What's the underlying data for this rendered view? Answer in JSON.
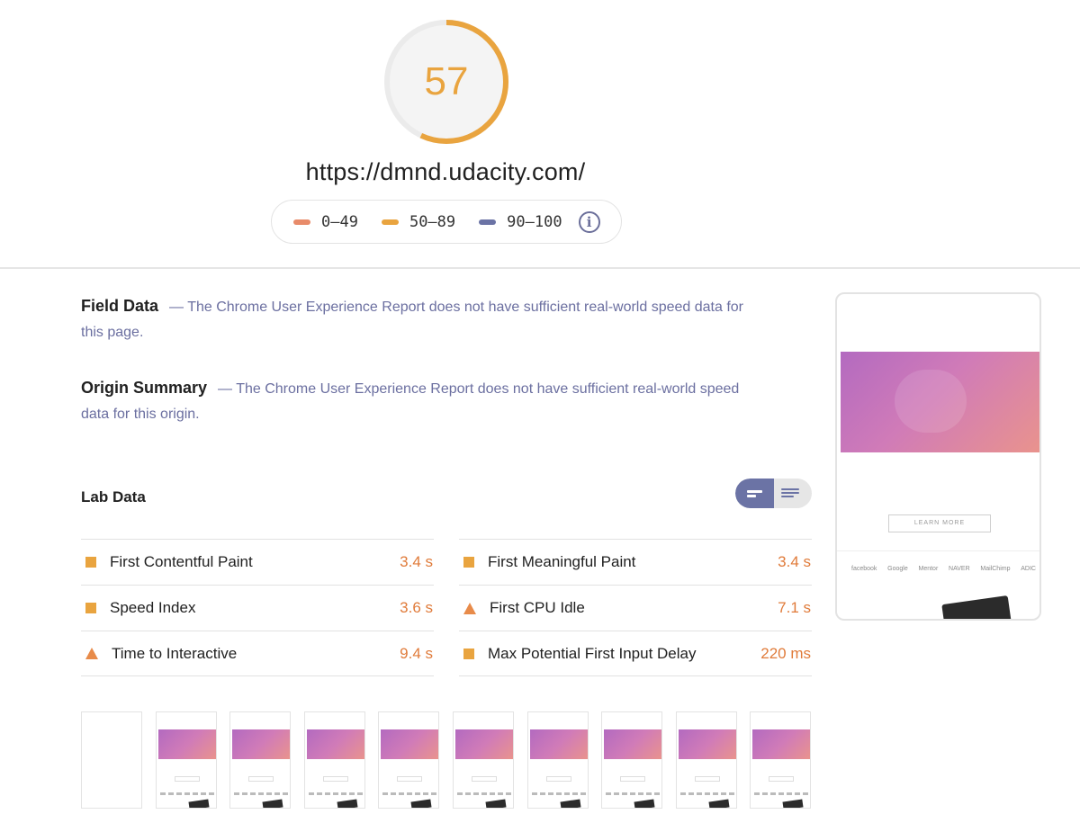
{
  "score": {
    "value": "57",
    "fraction": 0.57,
    "color": "#e9a43f"
  },
  "url": "https://dmnd.udacity.com/",
  "legend": {
    "items": [
      {
        "label": "0–49",
        "color": "#e88b6a"
      },
      {
        "label": "50–89",
        "color": "#e9a43f"
      },
      {
        "label": "90–100",
        "color": "#6b73a5"
      }
    ],
    "info_icon": "info-icon"
  },
  "field_data": {
    "heading": "Field Data",
    "text": "— The Chrome User Experience Report does not have sufficient real-world speed data for this page."
  },
  "origin_summary": {
    "heading": "Origin Summary",
    "text": "— The Chrome User Experience Report does not have sufficient real-world speed data for this origin."
  },
  "lab_data": {
    "heading": "Lab Data",
    "toggle": {
      "left_icon": "collapsed-view-icon",
      "right_icon": "expanded-view-icon"
    },
    "metrics_left": [
      {
        "label": "First Contentful Paint",
        "value": "3.4 s",
        "icon": "square"
      },
      {
        "label": "Speed Index",
        "value": "3.6 s",
        "icon": "square"
      },
      {
        "label": "Time to Interactive",
        "value": "9.4 s",
        "icon": "triangle"
      }
    ],
    "metrics_right": [
      {
        "label": "First Meaningful Paint",
        "value": "3.4 s",
        "icon": "square"
      },
      {
        "label": "First CPU Idle",
        "value": "7.1 s",
        "icon": "triangle"
      },
      {
        "label": "Max Potential First Input Delay",
        "value": "220 ms",
        "icon": "square"
      }
    ]
  },
  "preview": {
    "button_label": "LEARN MORE",
    "logos": [
      "facebook",
      "Google",
      "Mentor",
      "NAVER",
      "MailChimp",
      "ADIC"
    ]
  },
  "filmstrip": {
    "frame_count": 10,
    "blank_frames": 1
  }
}
